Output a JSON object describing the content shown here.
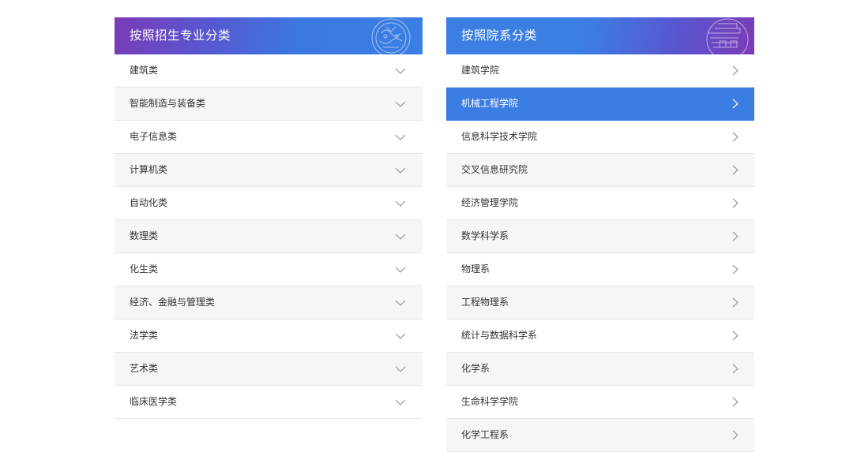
{
  "left_panel": {
    "title": "按照招生专业分类",
    "items": [
      {
        "label": "建筑类"
      },
      {
        "label": "智能制造与装备类"
      },
      {
        "label": "电子信息类"
      },
      {
        "label": "计算机类"
      },
      {
        "label": "自动化类"
      },
      {
        "label": "数理类"
      },
      {
        "label": "化生类"
      },
      {
        "label": "经济、金融与管理类"
      },
      {
        "label": "法学类"
      },
      {
        "label": "艺术类"
      },
      {
        "label": "临床医学类"
      }
    ],
    "item_icon": "chevron-down-icon"
  },
  "right_panel": {
    "title": "按照院系分类",
    "items": [
      {
        "label": "建筑学院"
      },
      {
        "label": "机械工程学院",
        "active": true
      },
      {
        "label": "信息科学技术学院"
      },
      {
        "label": "交叉信息研究院"
      },
      {
        "label": "经济管理学院"
      },
      {
        "label": "数学科学系"
      },
      {
        "label": "物理系"
      },
      {
        "label": "工程物理系"
      },
      {
        "label": "统计与数据科学系"
      },
      {
        "label": "化学系"
      },
      {
        "label": "生命科学学院"
      },
      {
        "label": "化学工程系"
      }
    ],
    "item_icon": "chevron-right-icon"
  },
  "colors": {
    "header_purple": "#7b3bb6",
    "header_blue": "#3b7fe3",
    "active_row": "#3b7de3",
    "alt_row": "#f6f6f6",
    "text": "#333333"
  }
}
